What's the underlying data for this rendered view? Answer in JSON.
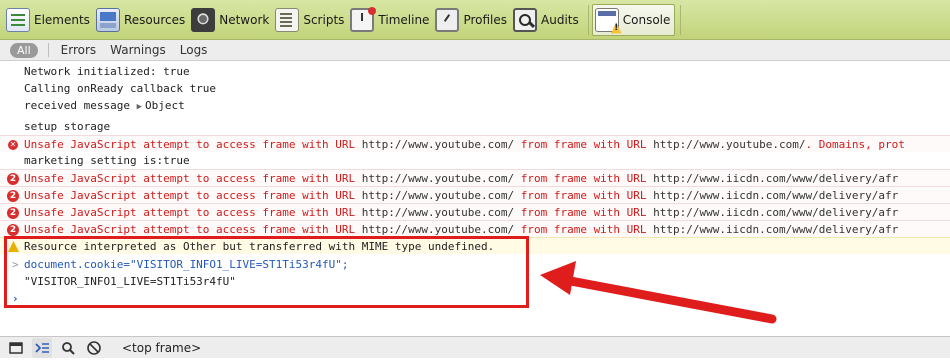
{
  "toolbar": {
    "tabs": [
      {
        "label": "Elements",
        "icon": "elements-icon"
      },
      {
        "label": "Resources",
        "icon": "resources-icon"
      },
      {
        "label": "Network",
        "icon": "network-icon"
      },
      {
        "label": "Scripts",
        "icon": "scripts-icon"
      },
      {
        "label": "Timeline",
        "icon": "timeline-icon"
      },
      {
        "label": "Profiles",
        "icon": "profiles-icon"
      },
      {
        "label": "Audits",
        "icon": "audits-icon"
      },
      {
        "label": "Console",
        "icon": "console-icon",
        "active": true
      }
    ]
  },
  "filters": {
    "all": "All",
    "items": [
      "Errors",
      "Warnings",
      "Logs"
    ]
  },
  "log": {
    "l1": "Network initialized: true",
    "l2": "Calling onReady callback true",
    "l3_text": "received message ",
    "l3_object": "Object",
    "l4": "setup storage",
    "e1_text": "Unsafe JavaScript attempt to access frame with URL ",
    "e1_url1": "http://www.youtube.com/",
    "e1_mid": " from frame with URL ",
    "e1_url2": "http://www.youtube.com/",
    "e1_tail": ". Domains, prot",
    "l5": "marketing setting is:true",
    "error_count": "2",
    "e2_text": "Unsafe JavaScript attempt to access frame with URL ",
    "e2_url1": "http://www.youtube.com/",
    "e2_mid": " from frame with URL ",
    "e2_url2": "http://www.iicdn.com/www/delivery/afr",
    "e3_url2": "http://www.iicdn.com/www/delivery/afr",
    "e4_url2": "http://www.iicdn.com/www/delivery/afr",
    "e5_url2": "http://www.iicdn.com/www/delivery/afr",
    "warn": "Resource interpreted as Other but transferred with MIME type undefined.",
    "cmd": "document.cookie=\"VISITOR_INFO1_LIVE=ST1Ti53r4fU\";",
    "result": "\"VISITOR_INFO1_LIVE=ST1Ti53r4fU\"",
    "prompt_symbol": ">",
    "input_prompt": "›"
  },
  "bottombar": {
    "frame_label": "<top frame>"
  },
  "colors": {
    "toolbar_bg": "#c9d98a",
    "error_red": "#d11a1a",
    "annotation_red": "#e01d1d",
    "command_blue": "#2457b8"
  }
}
